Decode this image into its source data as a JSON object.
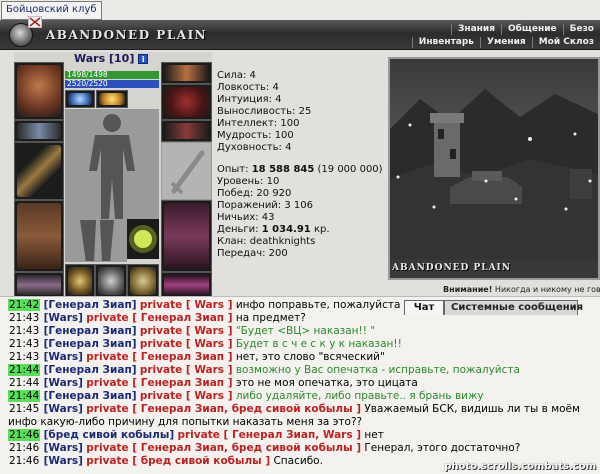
{
  "window": {
    "tab_title": "Бойцовский клуб"
  },
  "header": {
    "logo": "ABANDONED PLAIN",
    "menu_top": [
      "Знания",
      "Общение",
      "Безо"
    ],
    "menu_bottom": [
      "Инвентарь",
      "Умения",
      "Мой Склоз"
    ]
  },
  "character": {
    "name": "Wars",
    "level": "[10]",
    "info_badge": "i",
    "hp": "1498/1498",
    "mp": "2520/2520"
  },
  "stats": {
    "strength": "Сила: 4",
    "agility": "Ловкость: 4",
    "intuition": "Интуиция: 4",
    "endurance": "Выносливость: 25",
    "intellect": "Интеллект: 100",
    "wisdom": "Мудрость: 100",
    "spirit": "Духовность: 4",
    "exp_label": "Опыт:",
    "exp_value": "18 588 845",
    "exp_next": "(19 000 000)",
    "level": "Уровень: 10",
    "wins": "Побед: 20 920",
    "losses": "Поражений: 3 106",
    "draws": "Ничьих: 43",
    "money_label": "Деньги:",
    "money_value": "1 034.91",
    "money_unit": "кр.",
    "clan": "Клан: deathknights",
    "transfers": "Передач: 200"
  },
  "location": {
    "caption": "ABANDONED PLAIN",
    "notice_bold": "Внимание!",
    "notice_text": "Никогда и никому не говори"
  },
  "chat_tabs": {
    "chat": "Чат",
    "system": "Системные сообщения"
  },
  "chat": [
    {
      "time": "21:42",
      "hl": true,
      "from": "[Генерал Зиап]",
      "to": "private [ Wars ]",
      "msg": "инфо поправьте, пожалуйста",
      "green": false
    },
    {
      "time": "21:43",
      "hl": false,
      "from": "[Wars]",
      "to": "private [ Генерал Зиап ]",
      "msg": "на предмет?",
      "green": false
    },
    {
      "time": "21:43",
      "hl": false,
      "from": "[Генерал Зиап]",
      "to": "private [ Wars ]",
      "msg": "\"Будет <ВЦ> наказан!! \"",
      "green": true
    },
    {
      "time": "21:43",
      "hl": false,
      "from": "[Генерал Зиап]",
      "to": "private [ Wars ]",
      "msg": "Будет в с ч е с к у к наказан!!",
      "green": true
    },
    {
      "time": "21:43",
      "hl": false,
      "from": "[Wars]",
      "to": "private [ Генерал Зиап ]",
      "msg": "нет, это слово \"всяческий\"",
      "green": false
    },
    {
      "time": "21:44",
      "hl": true,
      "from": "[Генерал Зиап]",
      "to": "private [ Wars ]",
      "msg": "возможно у Вас опечатка - исправьте, пожалуйста",
      "green": true
    },
    {
      "time": "21:44",
      "hl": false,
      "from": "[Wars]",
      "to": "private [ Генерал Зиап ]",
      "msg": "это не моя опечатка, это цицата",
      "green": false
    },
    {
      "time": "21:44",
      "hl": true,
      "from": "[Генерал Зиап]",
      "to": "private [ Wars ]",
      "msg": "либо удаляйте, либо правьте.. я брань вижу",
      "green": true
    },
    {
      "time": "21:45",
      "hl": false,
      "from": "[Wars]",
      "to": "private [ Генерал Зиап, бред сивой кобылы ]",
      "msg": "Уважаемый БСК, видишь ли ты в моём",
      "green": false,
      "cont": "инфо какую-либо причину для попытки наказать меня за это??"
    },
    {
      "time": "21:46",
      "hl": true,
      "from": "[бред сивой кобылы]",
      "to": "private [ Генерал Зиап, Wars ]",
      "msg": "нет",
      "green": false
    },
    {
      "time": "21:46",
      "hl": false,
      "from": "[Wars]",
      "to": "private [ Генерал Зиап, бред сивой кобылы ]",
      "msg": "Генерал, этого достаточно?",
      "green": false
    },
    {
      "time": "21:46",
      "hl": false,
      "from": "[Wars]",
      "to": "private [ бред сивой кобылы ]",
      "msg": "Спасибо.",
      "green": false
    }
  ],
  "watermark": "photo.scrolls.combats.com",
  "colors": {
    "hp": "#2f9a2f",
    "mp": "#2d4fc2",
    "private": "#c02020",
    "nick": "#1a2a7a",
    "time_highlight": "#58e058"
  }
}
